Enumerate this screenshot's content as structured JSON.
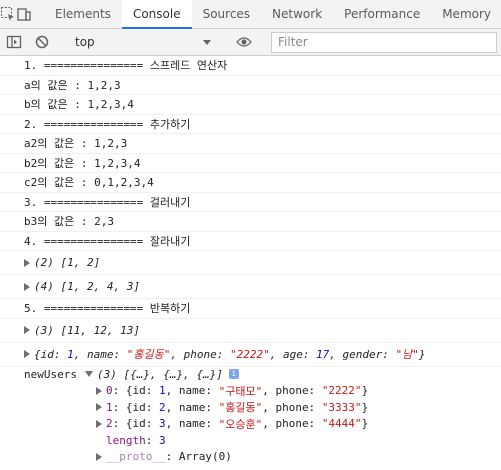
{
  "tabs": [
    "Elements",
    "Console",
    "Sources",
    "Network",
    "Performance",
    "Memory"
  ],
  "context": "top",
  "filter_placeholder": "Filter",
  "logs": [
    "1. =============== 스프레드 연산자",
    "a의 값은 : 1,2,3",
    "b의 값은 : 1,2,3,4",
    "2. =============== 추가하기",
    "a2의 값은 : 1,2,3",
    "b2의 값은 : 1,2,3,4",
    "c2의 값은 : 0,1,2,3,4",
    "3. =============== 걸러내기",
    "b3의 값은 : 2,3",
    "4. =============== 잘라내기",
    "5. =============== 반복하기"
  ],
  "arrays": {
    "slice1": {
      "count": "(2)",
      "values": "[1, 2]"
    },
    "slice2": {
      "count": "(4)",
      "values": "[1, 2, 4, 3]"
    },
    "repeat": {
      "count": "(3)",
      "values": "[11, 12, 13]"
    }
  },
  "object_line": {
    "open": "{id: ",
    "id": "1",
    "sep_name": ", name: ",
    "name": "\"홍길동\"",
    "sep_phone": ", phone: ",
    "phone": "\"2222\"",
    "sep_age": ", age: ",
    "age": "17",
    "sep_gender": ", gender: ",
    "gender": "\"남\"",
    "close": "}"
  },
  "new_users": {
    "label": "newUsers",
    "summary": "(3) [{…}, {…}, {…}]",
    "info_badge": "i",
    "items": [
      {
        "index": "0",
        "id": "1",
        "name": "\"구태모\"",
        "phone": "\"2222\""
      },
      {
        "index": "1",
        "id": "2",
        "name": "\"홍길동\"",
        "phone": "\"3333\""
      },
      {
        "index": "2",
        "id": "3",
        "name": "\"오승훈\"",
        "phone": "\"4444\""
      }
    ],
    "length_key": "length",
    "length_value": "3",
    "proto_key": "__proto__",
    "proto_value": "Array(0)"
  }
}
